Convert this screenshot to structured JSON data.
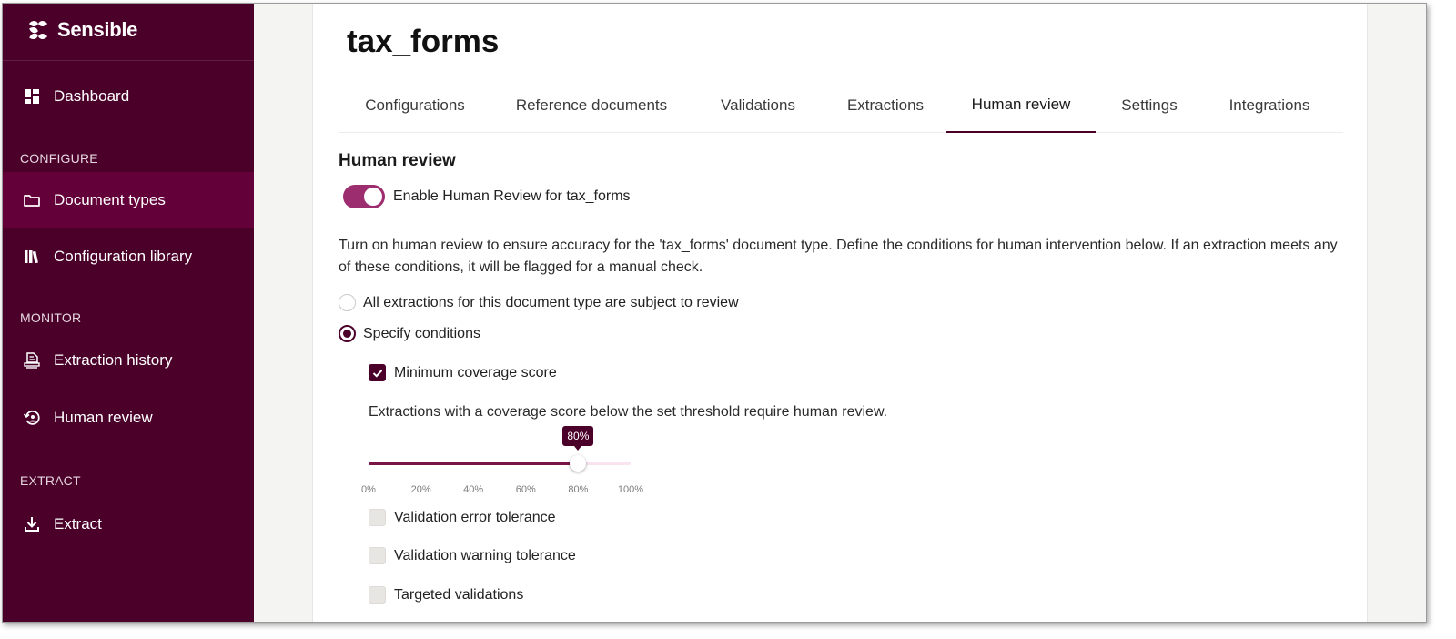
{
  "brand": {
    "name": "Sensible"
  },
  "sidebar": {
    "dashboard": "Dashboard",
    "sections": {
      "configure": "CONFIGURE",
      "monitor": "MONITOR",
      "extract": "EXTRACT"
    },
    "items": {
      "document_types": "Document types",
      "configuration_library": "Configuration library",
      "extraction_history": "Extraction history",
      "human_review": "Human review",
      "extract": "Extract"
    },
    "active_item": "Document types"
  },
  "main": {
    "title": "tax_forms",
    "tabs": [
      "Configurations",
      "Reference documents",
      "Validations",
      "Extractions",
      "Human review",
      "Settings",
      "Integrations"
    ],
    "active_tab": "Human review",
    "section_title": "Human review",
    "toggle": {
      "label": "Enable Human Review for tax_forms",
      "on": true
    },
    "description": "Turn on human review to ensure accuracy for the 'tax_forms' document type. Define the conditions for human intervention below. If an extraction meets any of these conditions, it will be flagged for a manual check.",
    "radios": {
      "all": {
        "label": "All extractions for this document type are subject to review",
        "checked": false
      },
      "specify": {
        "label": "Specify conditions",
        "checked": true
      }
    },
    "conditions": {
      "min_coverage": {
        "label": "Minimum coverage score",
        "checked": true
      },
      "slider": {
        "description": "Extractions with a coverage score below the set threshold require human review.",
        "value_label": "80%",
        "value_percent": 80,
        "ticks": [
          "0%",
          "20%",
          "40%",
          "60%",
          "80%",
          "100%"
        ]
      },
      "validation_error": {
        "label": "Validation error tolerance",
        "checked": false
      },
      "validation_warning": {
        "label": "Validation warning tolerance",
        "checked": false
      },
      "targeted": {
        "label": "Targeted validations",
        "checked": false
      }
    }
  },
  "colors": {
    "sidebar_bg": "#4a0029",
    "sidebar_active": "#640039",
    "accent": "#4a0029",
    "toggle_on": "#9c2d6f",
    "slider_fill": "#7a1548",
    "slider_rail": "#f8e3ee"
  }
}
